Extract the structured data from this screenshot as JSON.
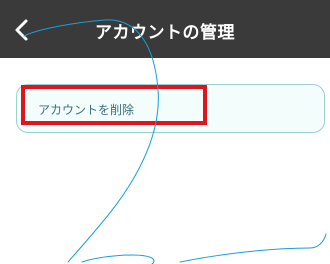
{
  "header": {
    "title": "アカウントの管理",
    "background_color": "#3a3a3a",
    "back_icon": "chevron-left-icon"
  },
  "menu": {
    "items": [
      {
        "label": "アカウントを削除"
      }
    ]
  },
  "annotation": {
    "highlight_color": "#e0141d",
    "stroke_color": "#1a9ed8"
  }
}
